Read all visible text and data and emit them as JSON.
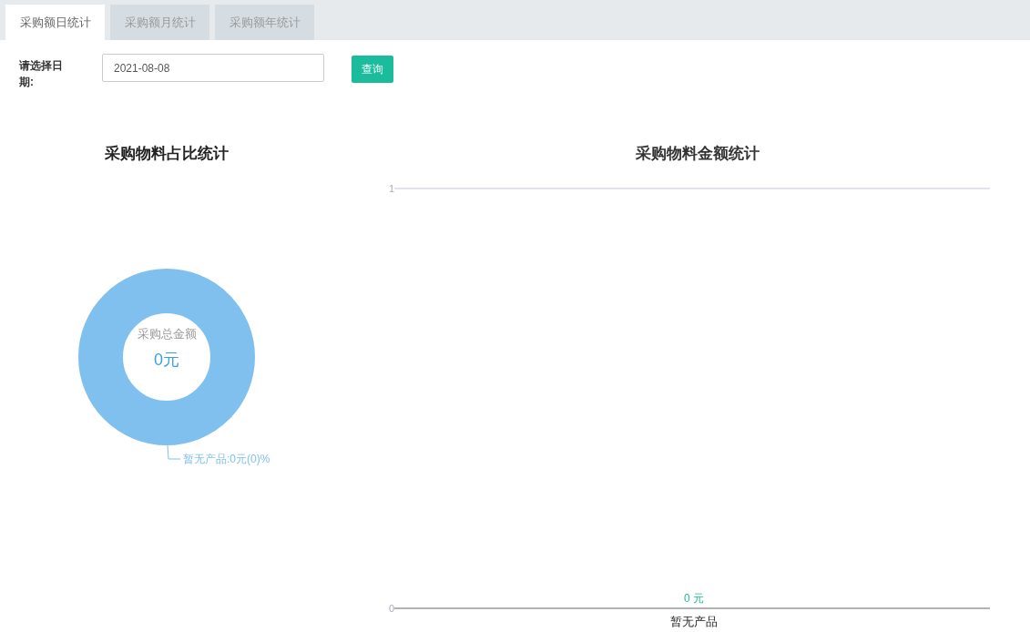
{
  "tabs": [
    {
      "label": "采购额日统计",
      "selected": true
    },
    {
      "label": "采购额月统计",
      "selected": false
    },
    {
      "label": "采购额年统计",
      "selected": false
    }
  ],
  "filter": {
    "label": "请选择日期:",
    "date_value": "2021-08-08",
    "query_button": "查询"
  },
  "pie_panel": {
    "title": "采购物料占比统计",
    "center_caption": "采购总金额",
    "center_value": "0元",
    "slice_label": "暂无产品:0元(0)%"
  },
  "bar_panel": {
    "title": "采购物料金额统计",
    "chart_data": {
      "type": "bar",
      "categories": [
        "暂无产品"
      ],
      "series": [
        {
          "color": "#1abc9c",
          "values": [
            0
          ]
        }
      ],
      "ylim": [
        0,
        1
      ],
      "yticks": [
        0,
        1
      ],
      "value_labels": [
        "0 元"
      ]
    }
  }
}
